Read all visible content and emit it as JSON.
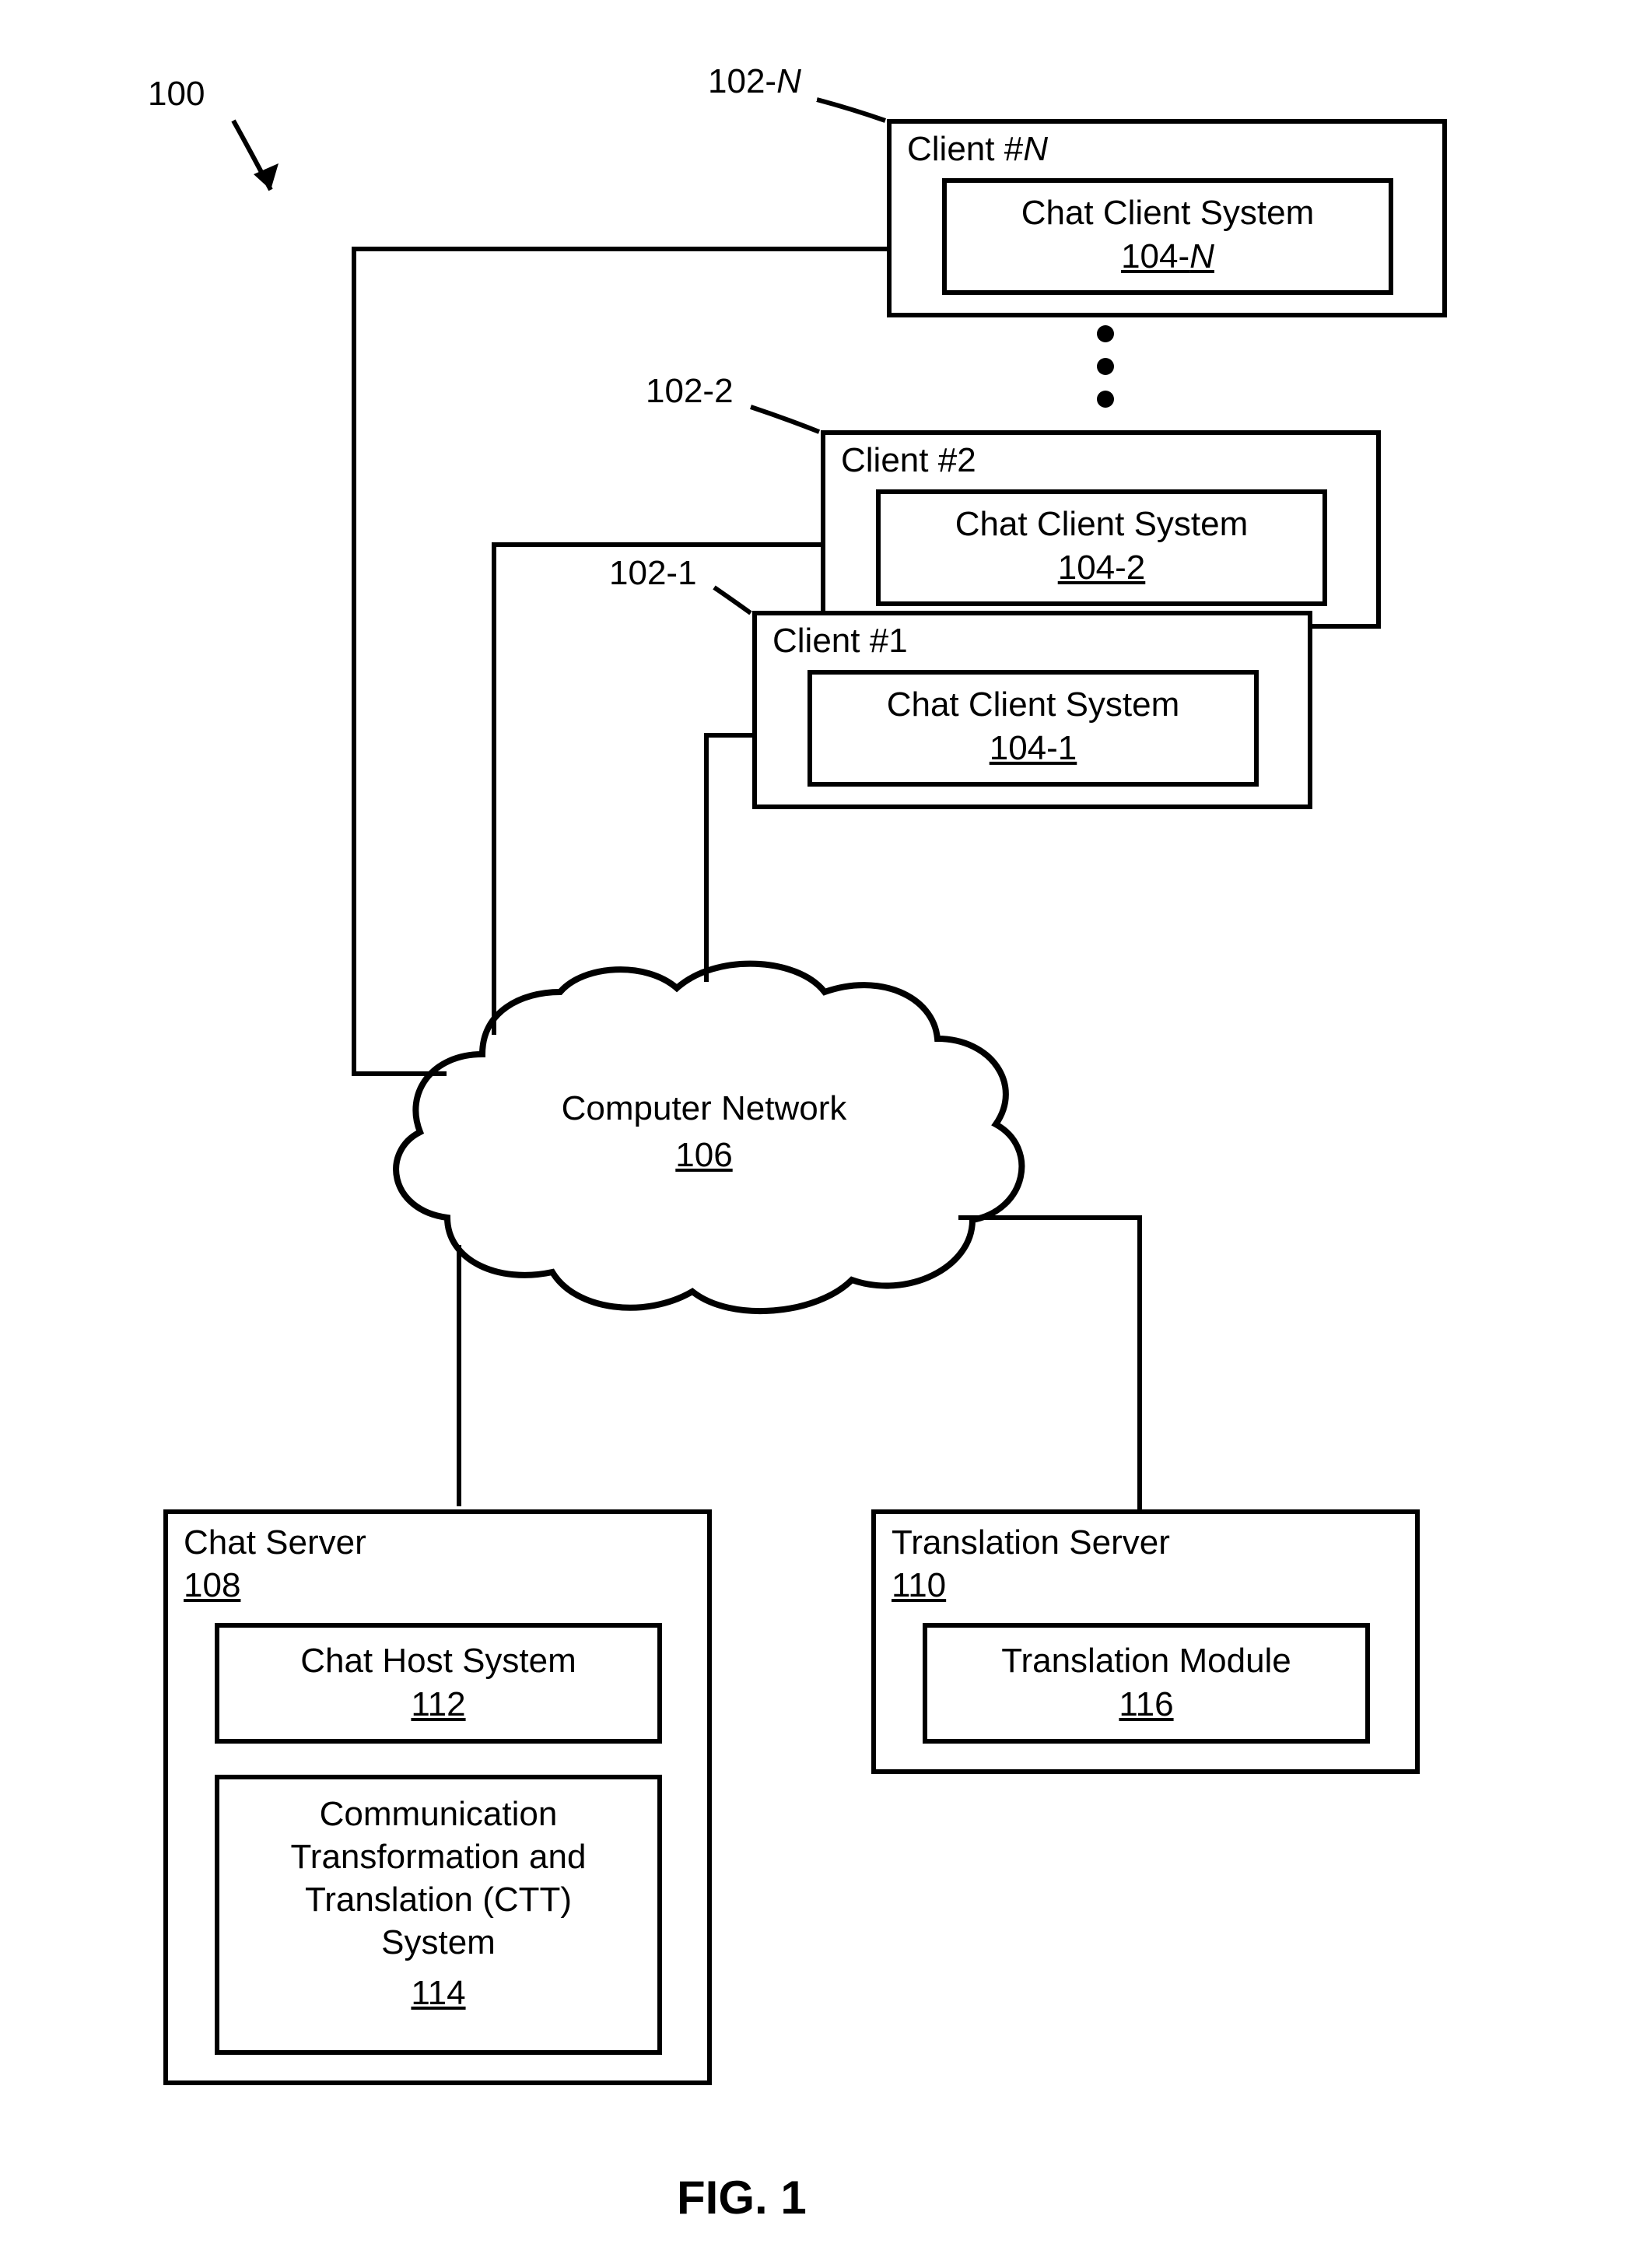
{
  "figure": {
    "ref_100": "100",
    "caption": "FIG. 1"
  },
  "clients": {
    "clientN": {
      "callout": "102-N",
      "title_prefix": "Client #",
      "title_suffix": "N",
      "inner_title": "Chat Client System",
      "inner_ref_prefix": "104-",
      "inner_ref_suffix": "N"
    },
    "client2": {
      "callout": "102-2",
      "title": "Client #2",
      "inner_title": "Chat Client System",
      "inner_ref": "104-2"
    },
    "client1": {
      "callout": "102-1",
      "title": "Client #1",
      "inner_title": "Chat Client System",
      "inner_ref": "104-1"
    }
  },
  "network": {
    "title": "Computer Network",
    "ref": "106"
  },
  "chat_server": {
    "title": "Chat Server",
    "ref": "108",
    "host": {
      "title": "Chat Host System",
      "ref": "112"
    },
    "ctt": {
      "line1": "Communication",
      "line2": "Transformation and",
      "line3": "Translation (CTT)",
      "line4": "System",
      "ref": "114"
    }
  },
  "translation_server": {
    "title": "Translation Server",
    "ref": "110",
    "module": {
      "title": "Translation Module",
      "ref": "116"
    }
  }
}
